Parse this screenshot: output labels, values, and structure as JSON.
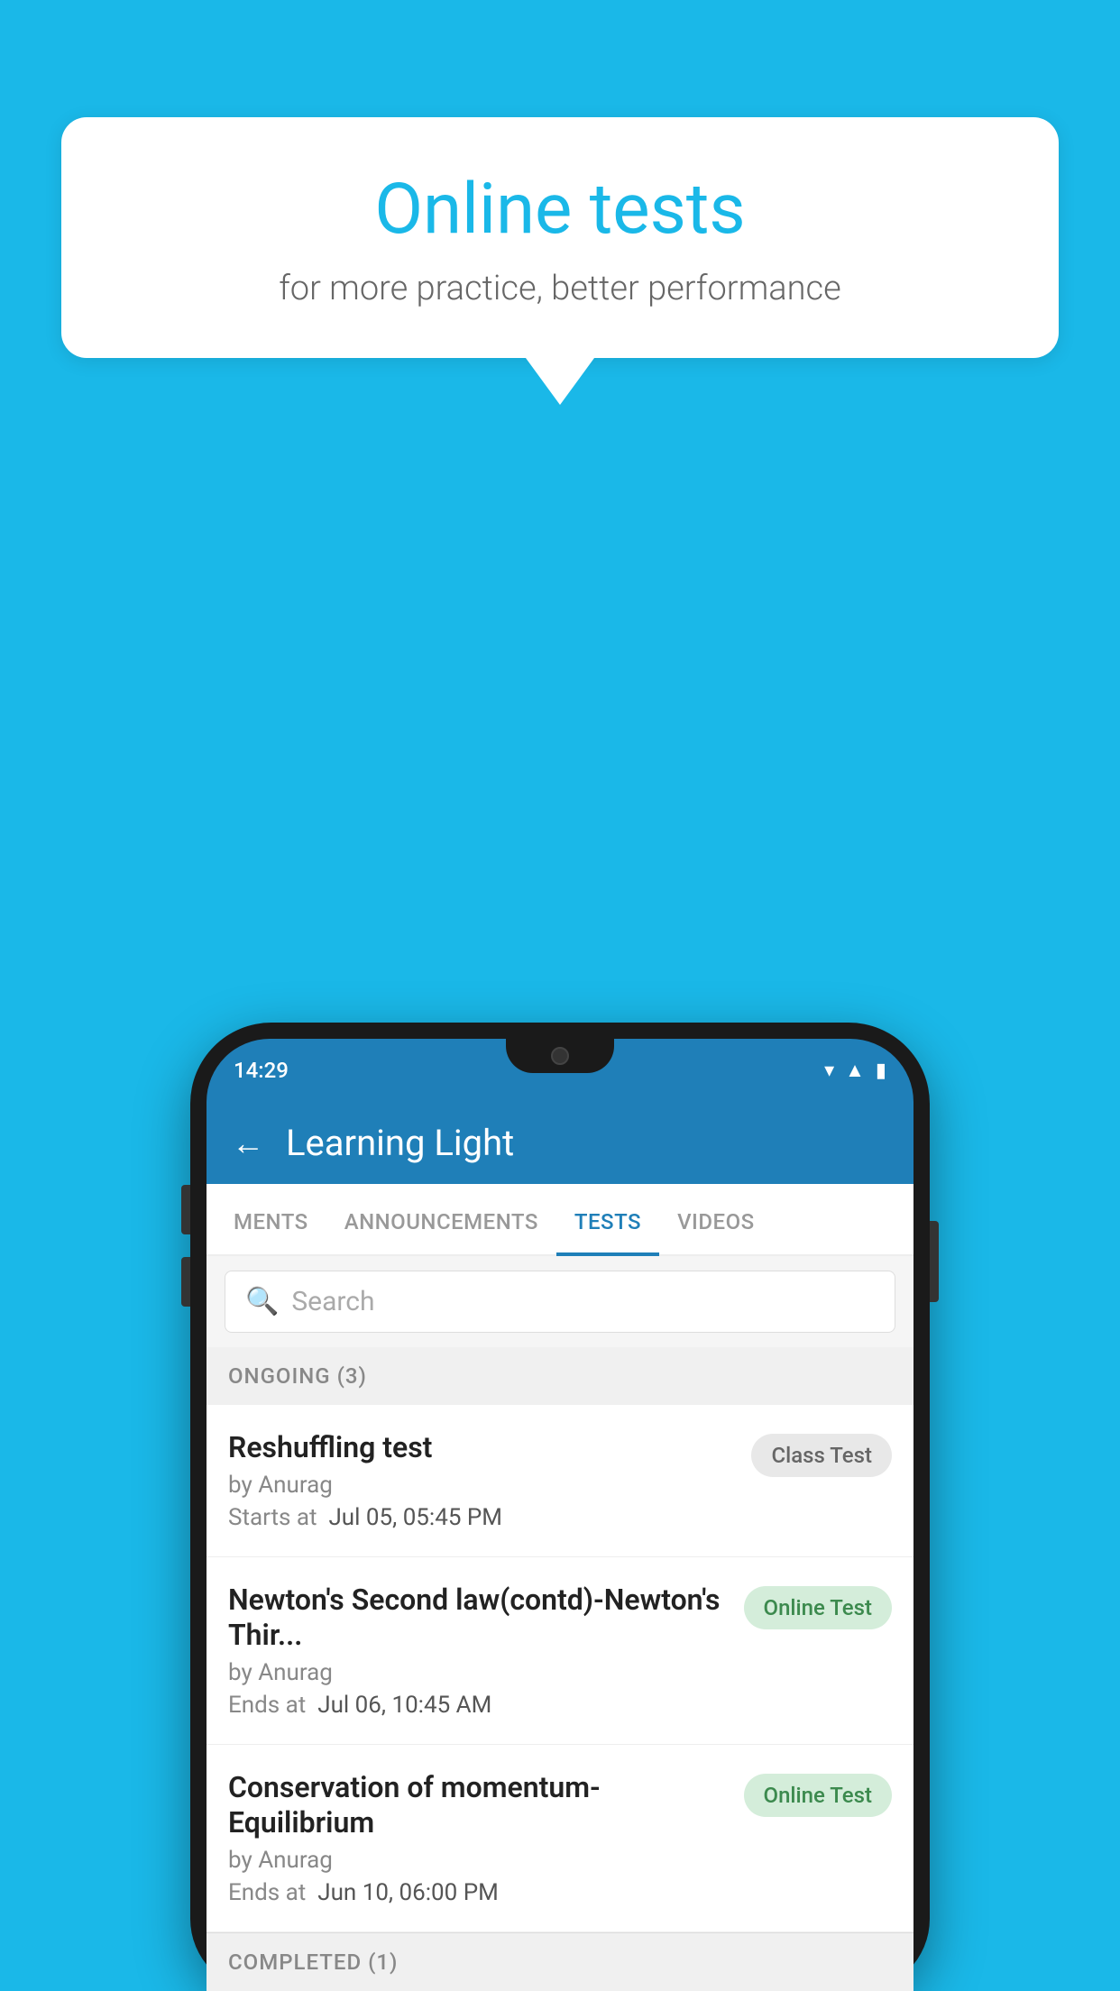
{
  "background": {
    "color": "#1ab8e8"
  },
  "speech_bubble": {
    "title": "Online tests",
    "subtitle": "for more practice, better performance"
  },
  "phone": {
    "status_bar": {
      "time": "14:29"
    },
    "app_header": {
      "back_label": "←",
      "title": "Learning Light"
    },
    "tabs": [
      {
        "label": "MENTS",
        "active": false
      },
      {
        "label": "ANNOUNCEMENTS",
        "active": false
      },
      {
        "label": "TESTS",
        "active": true
      },
      {
        "label": "VIDEOS",
        "active": false
      }
    ],
    "search": {
      "placeholder": "Search"
    },
    "section_ongoing": {
      "label": "ONGOING (3)"
    },
    "tests": [
      {
        "name": "Reshuffling test",
        "by": "by Anurag",
        "date_label": "Starts at",
        "date": "Jul 05, 05:45 PM",
        "badge": "Class Test",
        "badge_type": "class"
      },
      {
        "name": "Newton's Second law(contd)-Newton's Thir...",
        "by": "by Anurag",
        "date_label": "Ends at",
        "date": "Jul 06, 10:45 AM",
        "badge": "Online Test",
        "badge_type": "online"
      },
      {
        "name": "Conservation of momentum-Equilibrium",
        "by": "by Anurag",
        "date_label": "Ends at",
        "date": "Jun 10, 06:00 PM",
        "badge": "Online Test",
        "badge_type": "online"
      }
    ],
    "section_completed": {
      "label": "COMPLETED (1)"
    }
  }
}
